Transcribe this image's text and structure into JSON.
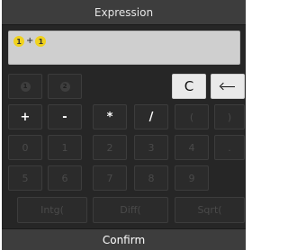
{
  "header": {
    "title": "Expression"
  },
  "expression": {
    "tokens": [
      "1",
      "+",
      "1"
    ]
  },
  "history": [
    "1",
    "2"
  ],
  "controls": {
    "clear": "C"
  },
  "operators": [
    "+",
    "-",
    "*",
    "/",
    "(",
    ")"
  ],
  "digits_row1": [
    "0",
    "1",
    "2",
    "3",
    "4",
    "."
  ],
  "digits_row2": [
    "5",
    "6",
    "7",
    "8",
    "9"
  ],
  "functions": [
    "Intg(",
    "Diff(",
    "Sqrt("
  ],
  "footer": {
    "confirm": "Confirm"
  },
  "icons": {
    "backspace": "backspace-arrow-icon"
  }
}
